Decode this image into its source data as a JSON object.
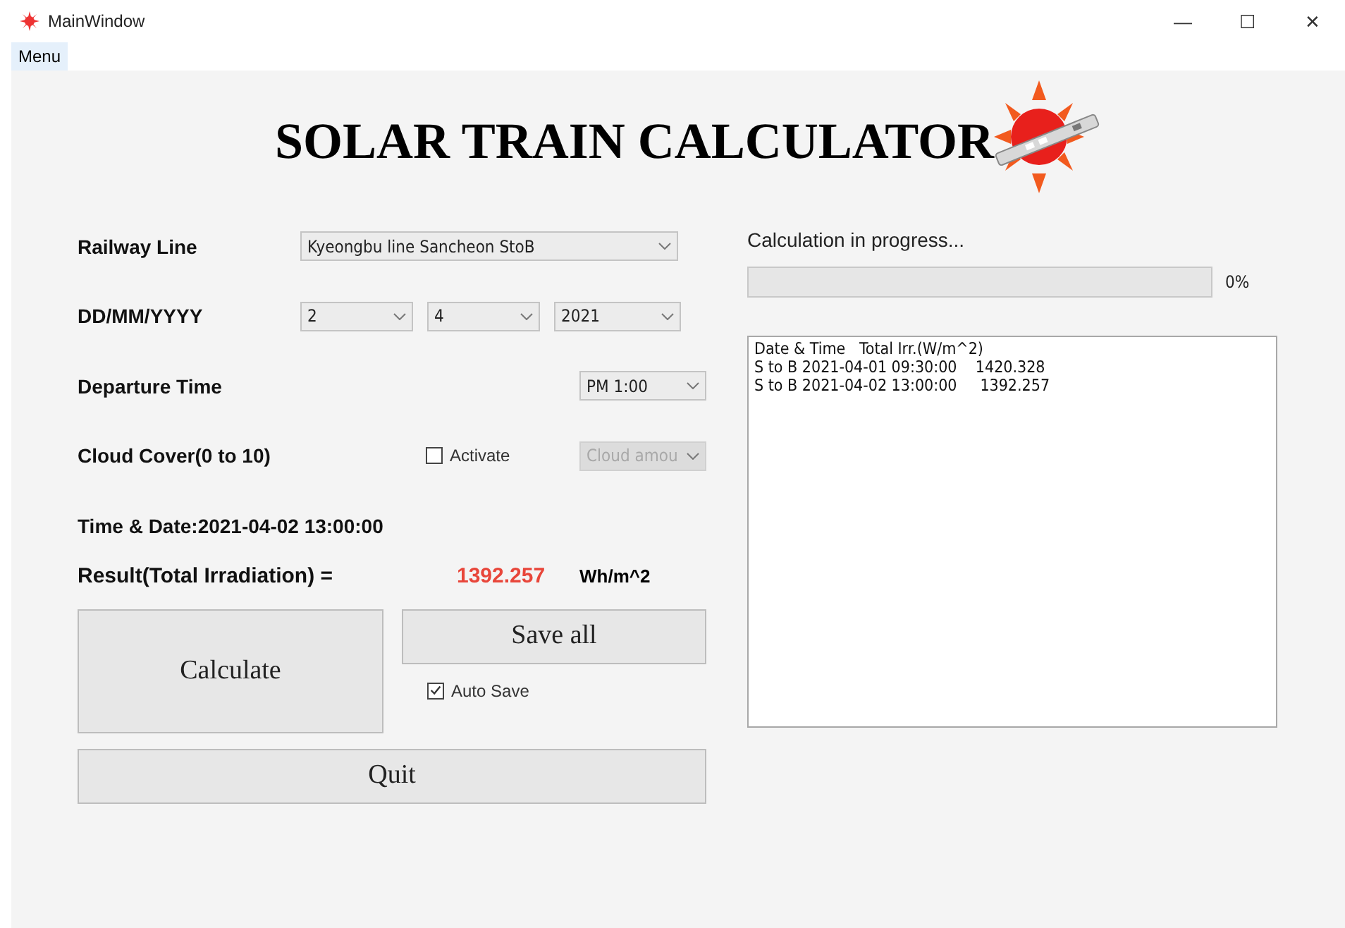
{
  "window": {
    "title": "MainWindow",
    "controls": [
      "—",
      "☐",
      "✕"
    ]
  },
  "menu": [
    {
      "label": "Menu",
      "selected": true
    }
  ],
  "header": {
    "title": "SOLAR TRAIN CALCULATOR"
  },
  "form": {
    "railway": {
      "label": "Railway Line",
      "value": "Kyeongbu line Sancheon StoB"
    },
    "date": {
      "label": "DD/MM/YYYY",
      "fields": [
        "2",
        "4",
        "2021"
      ]
    },
    "departure": {
      "label": "Departure Time",
      "value": "PM 1:00"
    },
    "cloud": {
      "label": "Cloud Cover(0 to 10)",
      "activate": {
        "label": "Activate",
        "checked": false
      },
      "value": "Cloud amou",
      "disabled": true
    },
    "time_date": "Time & Date:2021-04-02 13:00:00",
    "result": {
      "label": "Result(Total Irradiation) =",
      "value": "1392.257",
      "unit": "Wh/m^2"
    }
  },
  "buttons": {
    "calculate": "Calculate",
    "save_all": "Save all",
    "auto_save": {
      "label": "Auto Save",
      "checked": true
    },
    "quit": "Quit"
  },
  "progress": {
    "label": "Calculation in progress...",
    "level": 0,
    "reading": "0%"
  },
  "log": [
    "Date & Time   Total Irr.(W/m^2)",
    "S to B 2021-04-01 09:30:00    1420.328",
    "S to B 2021-04-02 13:00:00     1392.257"
  ]
}
